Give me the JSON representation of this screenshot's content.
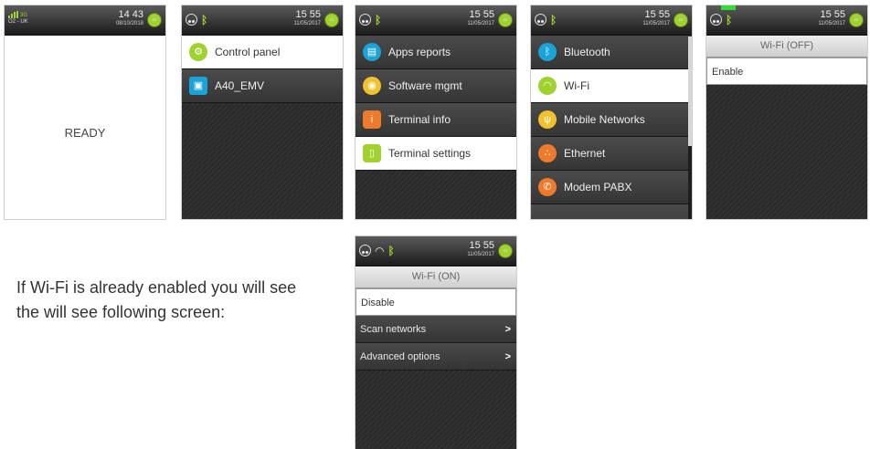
{
  "screen1": {
    "network": "O2 - UK",
    "network_gen": "3G",
    "time": "14 43",
    "date": "08/10/2018",
    "status": "READY"
  },
  "screen2": {
    "time": "15 55",
    "date": "11/05/2017",
    "items": [
      {
        "label": "Control panel",
        "icon": "gears-icon",
        "color": "#9fd12f"
      },
      {
        "label": "A40_EMV",
        "icon": "app-icon",
        "color": "#1aa3d9"
      }
    ]
  },
  "screen3": {
    "time": "15 55",
    "date": "11/05/2017",
    "items": [
      {
        "label": "Apps reports",
        "icon": "document-icon",
        "color": "#1aa3d9"
      },
      {
        "label": "Software mgmt",
        "icon": "disc-icon",
        "color": "#f2c12e"
      },
      {
        "label": "Terminal info",
        "icon": "info-icon",
        "color": "#f07a2b"
      },
      {
        "label": "Terminal settings",
        "icon": "settings-icon",
        "color": "#9fd12f"
      }
    ]
  },
  "screen4": {
    "time": "15 55",
    "date": "11/05/2017",
    "items": [
      {
        "label": "Bluetooth",
        "icon": "bluetooth-icon",
        "color": "#1aa3d9"
      },
      {
        "label": "Wi-Fi",
        "icon": "wifi-icon",
        "color": "#9fd12f"
      },
      {
        "label": "Mobile Networks",
        "icon": "antenna-icon",
        "color": "#f2c12e"
      },
      {
        "label": "Ethernet",
        "icon": "ethernet-icon",
        "color": "#f07a2b"
      },
      {
        "label": "Modem PABX",
        "icon": "phone-icon",
        "color": "#f07a2b"
      }
    ]
  },
  "screen5": {
    "time": "15 55",
    "date": "11/05/2017",
    "title": "Wi-Fi (OFF)",
    "options": [
      {
        "label": "Enable"
      }
    ]
  },
  "screen6": {
    "time": "15 55",
    "date": "11/05/2017",
    "title": "Wi-Fi (ON)",
    "options": [
      {
        "label": "Disable"
      },
      {
        "label": "Scan networks",
        "chevron": ">"
      },
      {
        "label": "Advanced options",
        "chevron": ">"
      }
    ]
  },
  "caption": "If Wi-Fi is already enabled you will see the will see following screen:",
  "colors": {
    "accent_green": "#9fd12f",
    "blue": "#1aa3d9",
    "orange": "#f07a2b",
    "yellow": "#f2c12e"
  }
}
